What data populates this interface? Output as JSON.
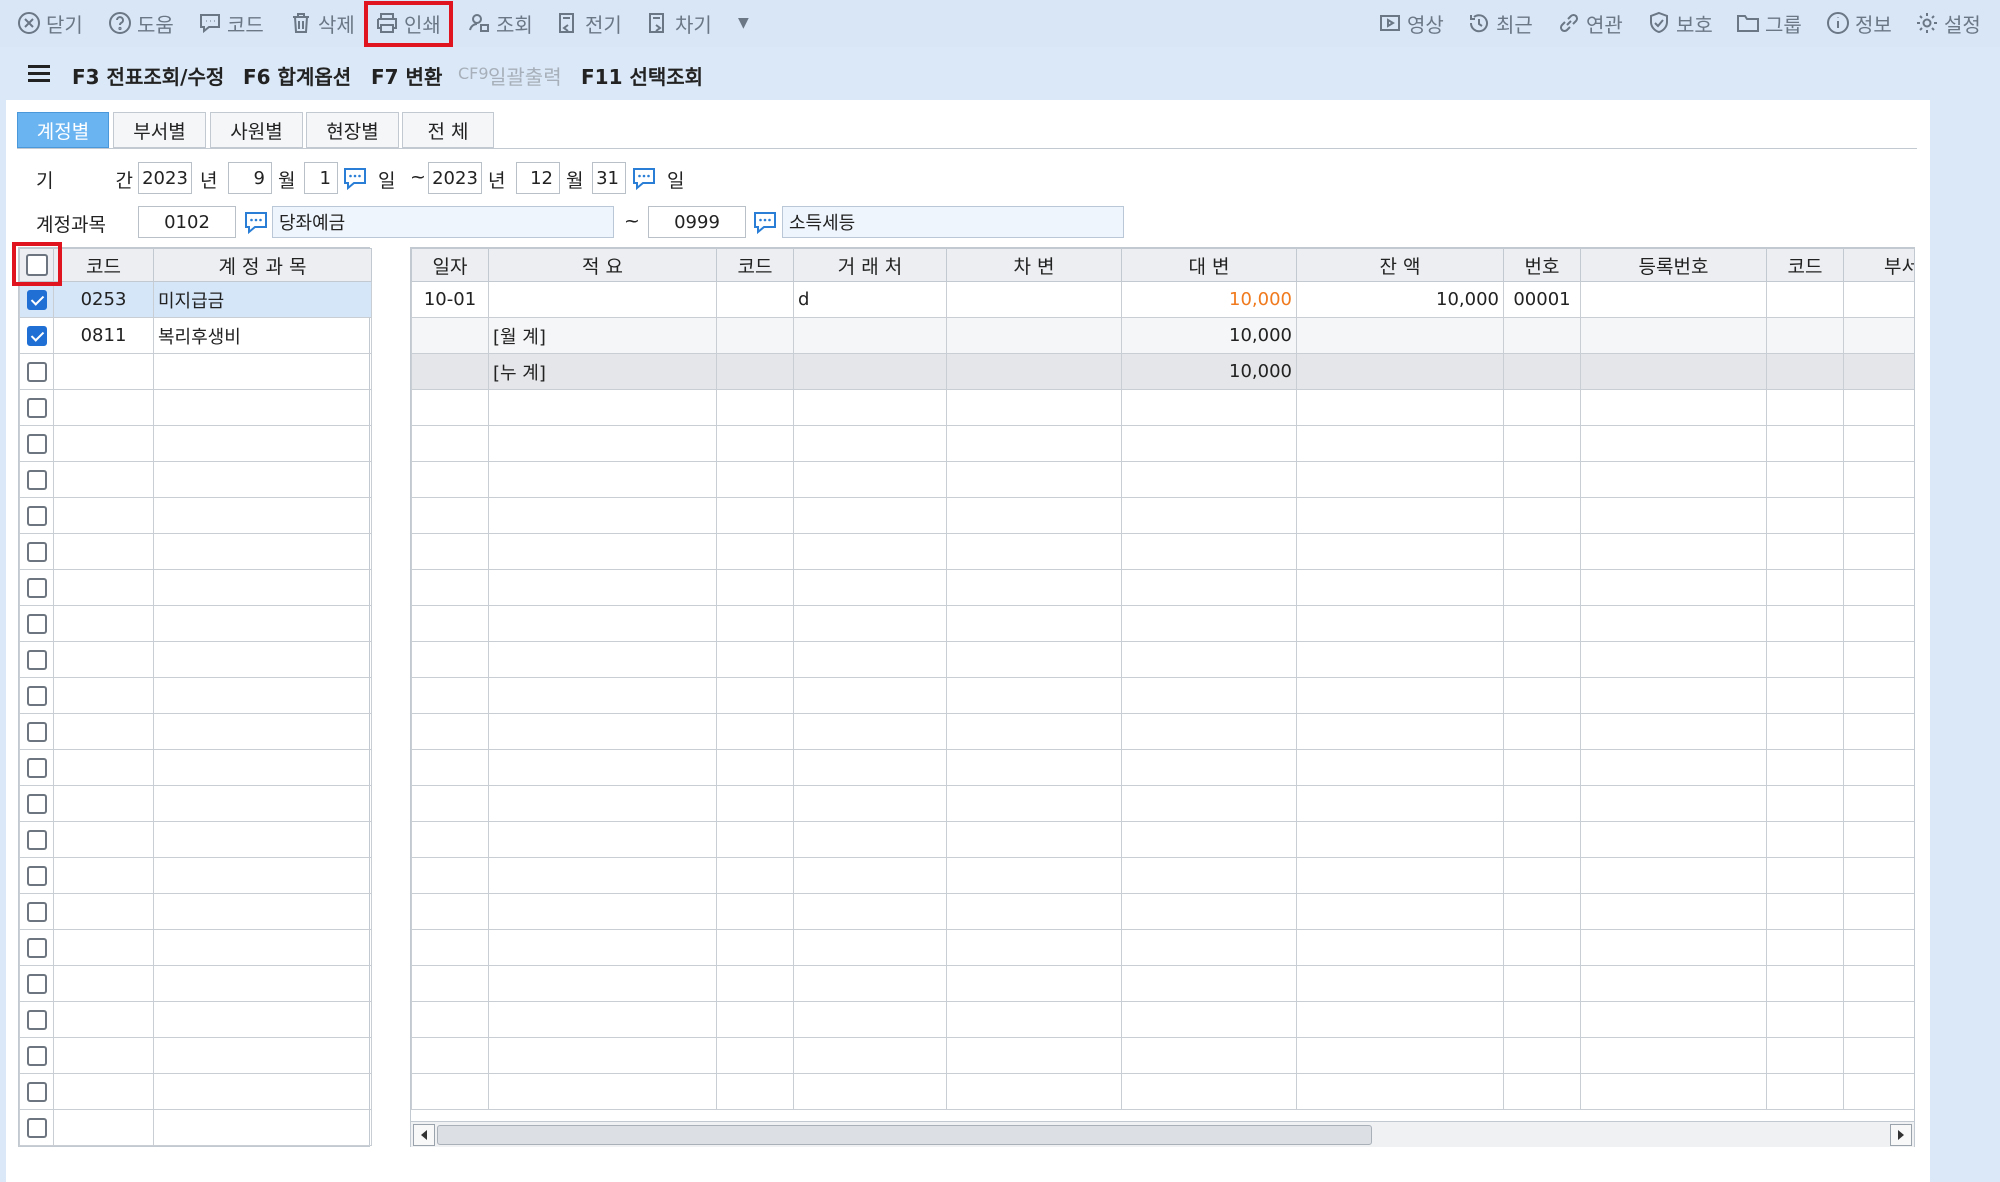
{
  "toolbar": {
    "left": [
      {
        "label": "닫기",
        "icon": "close-circle-icon"
      },
      {
        "label": "도움",
        "icon": "help-circle-icon"
      },
      {
        "label": "코드",
        "icon": "chat-icon"
      },
      {
        "label": "삭제",
        "icon": "trash-icon"
      },
      {
        "label": "인쇄",
        "icon": "printer-icon"
      },
      {
        "label": "조회",
        "icon": "search-user-icon"
      },
      {
        "label": "전기",
        "icon": "prev-doc-icon"
      },
      {
        "label": "차기",
        "icon": "next-doc-icon"
      }
    ],
    "right": [
      {
        "label": "영상",
        "icon": "video-icon"
      },
      {
        "label": "최근",
        "icon": "history-icon"
      },
      {
        "label": "연관",
        "icon": "link-icon"
      },
      {
        "label": "보호",
        "icon": "shield-icon"
      },
      {
        "label": "그룹",
        "icon": "folder-icon"
      },
      {
        "label": "정보",
        "icon": "info-icon"
      },
      {
        "label": "설정",
        "icon": "gear-icon"
      }
    ],
    "highlight_color": "#e0141e"
  },
  "fkeys": {
    "f3": "F3 전표조회/수정",
    "f6": "F6 합계옵션",
    "f7": "F7 변환",
    "cf9_key": "CF9",
    "cf9_label": "일괄출력",
    "f11": "F11 선택조회"
  },
  "tabs": [
    "계정별",
    "부서별",
    "사원별",
    "현장별",
    "전 체"
  ],
  "period": {
    "label": "기 간",
    "from_year": "2023",
    "from_month": "9",
    "from_day": "1",
    "to_year": "2023",
    "to_month": "12",
    "to_day": "31",
    "year_unit": "년",
    "month_unit": "월",
    "day_unit": "일",
    "tilde": "~"
  },
  "account": {
    "label": "계정과목",
    "from_code": "0102",
    "from_name": "당좌예금",
    "to_code": "0999",
    "to_name": "소득세등"
  },
  "left_grid": {
    "headers": [
      "코드",
      "계 정 과 목"
    ],
    "rows": [
      {
        "checked": true,
        "code": "0253",
        "name": "미지급금"
      },
      {
        "checked": true,
        "code": "0811",
        "name": "복리후생비"
      }
    ]
  },
  "right_grid": {
    "headers": [
      "일자",
      "적 요",
      "코드",
      "거 래 처",
      "차   변",
      "대   변",
      "잔   액",
      "번호",
      "등록번호",
      "코드",
      "부서"
    ],
    "rows": [
      {
        "date": "10-01",
        "memo": "",
        "code": "",
        "vendor": "d",
        "debit": "",
        "credit": "10,000",
        "balance": "10,000",
        "no": "00001"
      },
      {
        "date": "",
        "memo": "[월         계]",
        "code": "",
        "vendor": "",
        "debit": "",
        "credit": "10,000",
        "balance": "",
        "no": ""
      },
      {
        "date": "",
        "memo": "[누         계]",
        "code": "",
        "vendor": "",
        "debit": "",
        "credit": "10,000",
        "balance": "",
        "no": ""
      }
    ]
  }
}
